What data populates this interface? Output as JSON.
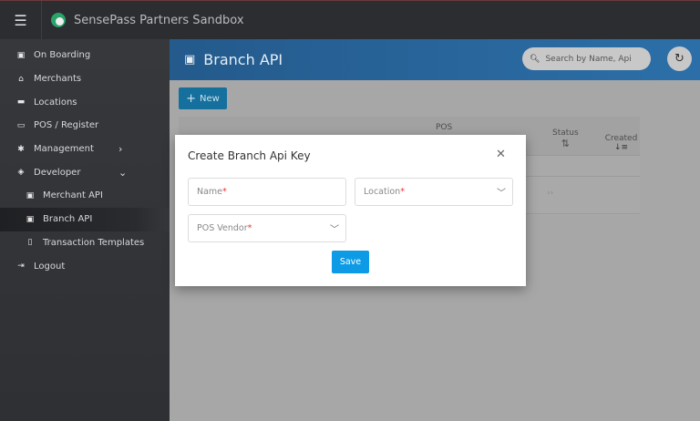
{
  "app": {
    "title": "SensePass Partners Sandbox"
  },
  "sidebar": {
    "items": [
      {
        "label": "On Boarding",
        "icon": "id-badge-icon",
        "glyph": "▣"
      },
      {
        "label": "Merchants",
        "icon": "bank-icon",
        "glyph": "⌂"
      },
      {
        "label": "Locations",
        "icon": "store-icon",
        "glyph": "▬"
      },
      {
        "label": "POS / Register",
        "icon": "register-icon",
        "glyph": "▭"
      },
      {
        "label": "Management",
        "icon": "cog-icon",
        "glyph": "✱",
        "chevron": "›"
      },
      {
        "label": "Developer",
        "icon": "developer-icon",
        "glyph": "◈",
        "chevron": "⌄"
      },
      {
        "label": "Merchant API",
        "icon": "api-icon",
        "glyph": "▣"
      },
      {
        "label": "Branch API",
        "icon": "api-icon",
        "glyph": "▣"
      },
      {
        "label": "Transaction Templates",
        "icon": "clipboard-icon",
        "glyph": "▯"
      },
      {
        "label": "Logout",
        "icon": "logout-icon",
        "glyph": "⇥"
      }
    ]
  },
  "page": {
    "title": "Branch API",
    "search_placeholder": "Search by Name, Api",
    "new_label": "New"
  },
  "table": {
    "headers": {
      "pos": "POS",
      "status": "Status",
      "created": "Created"
    },
    "pager": "››"
  },
  "modal": {
    "title": "Create Branch Api Key",
    "name_placeholder": "Name",
    "location_placeholder": "Location",
    "pos_vendor_placeholder": "POS Vendor",
    "required_mark": "*",
    "save_label": "Save"
  }
}
